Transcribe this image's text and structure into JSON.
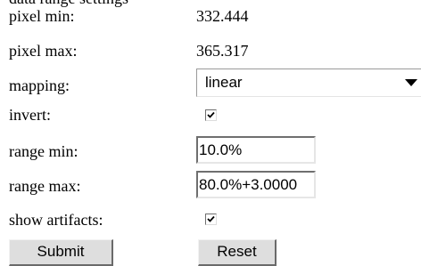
{
  "clipped_top_text": "data range settings",
  "form": {
    "pixel_min": {
      "label": "pixel min:",
      "value": "332.444"
    },
    "pixel_max": {
      "label": "pixel max:",
      "value": "365.317"
    },
    "mapping": {
      "label": "mapping:",
      "selected": "linear"
    },
    "invert": {
      "label": "invert:",
      "checked": true
    },
    "range_min": {
      "label": "range min:",
      "value": "10.0%"
    },
    "range_max": {
      "label": "range max:",
      "value": "80.0%+3.0000"
    },
    "show_artifacts": {
      "label": "show artifacts:",
      "checked": true
    },
    "buttons": {
      "submit": "Submit",
      "reset": "Reset"
    }
  },
  "icons": {
    "dropdown": "chevron-down-icon",
    "checkmark": "checkmark-icon"
  }
}
